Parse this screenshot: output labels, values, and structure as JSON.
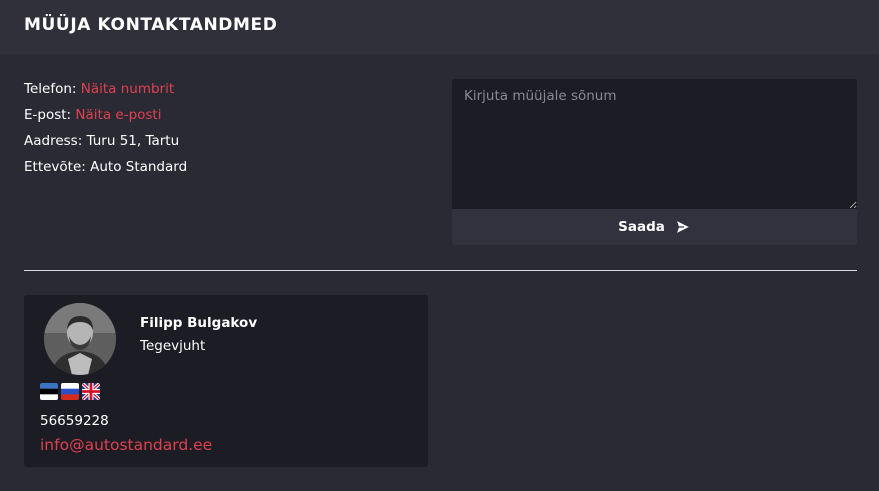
{
  "header": {
    "title": "MÜÜJA KONTAKTANDMED"
  },
  "contact": {
    "phone_label": "Telefon:",
    "phone_link": "Näita numbrit",
    "email_label": "E-post:",
    "email_link": "Näita e-posti",
    "address": "Aadress: Turu 51, Tartu",
    "company": "Ettevõte: Auto Standard"
  },
  "message": {
    "placeholder": "Kirjuta müüjale sõnum",
    "send_label": "Saada"
  },
  "seller": {
    "name": "Filipp Bulgakov",
    "role": "Tegevjuht",
    "languages": [
      "Estonian",
      "Russian",
      "English"
    ],
    "phone": "56659228",
    "email": "info@autostandard.ee"
  },
  "colors": {
    "accent": "#e0404e",
    "background": "#2a2a35",
    "header": "#30303b",
    "panel": "#1c1c25",
    "button": "#32323e"
  }
}
